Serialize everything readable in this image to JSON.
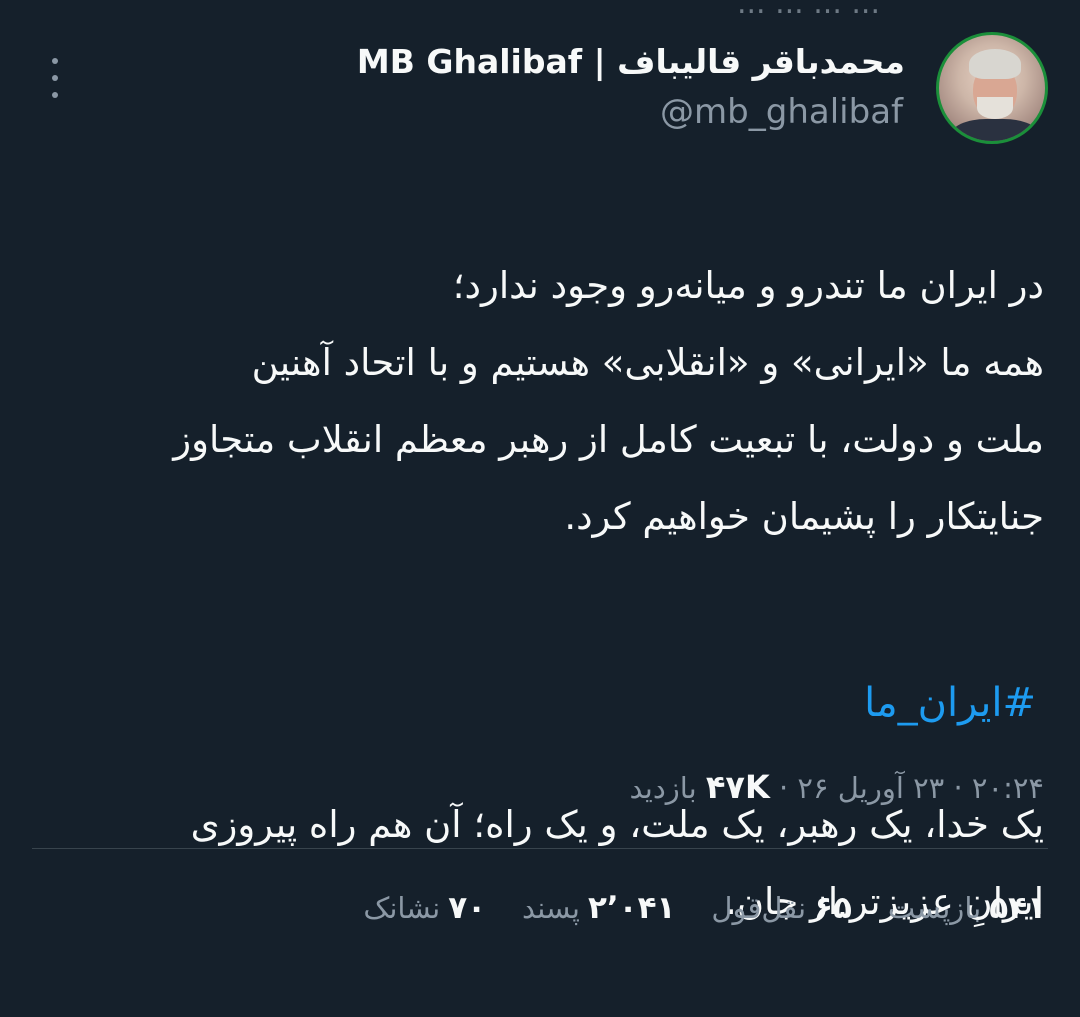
{
  "top_cut_text": "... ... ... ...",
  "header": {
    "display_name": "محمدباقر قالیباف | MB Ghalibaf",
    "handle": "@mb_ghalibaf",
    "more_icon": "more-vertical-icon"
  },
  "tweet": {
    "paragraph_1": "در ایران ما تندرو و میانه‌رو وجود ندارد؛\nهمه ما «ایرانی» و «انقلابی» هستیم و با اتحاد آهنین\nملت و دولت، با تبعیت کامل از رهبر معظم انقلاب متجاوز\nجنایتکار را پشیمان خواهیم کرد.",
    "paragraph_2": "یک خدا، یک رهبر، یک ملت، و یک راه؛ آن هم راه پیروزی\nایرانِ عزیزتر از جان.",
    "hashtag": "#ایران_ما"
  },
  "meta": {
    "time": "۲۰:۲۴",
    "date": "۲۳ آوریل ۲۶",
    "views_count": "۴۷K",
    "views_label": "بازدید",
    "separator": "·"
  },
  "stats": [
    {
      "count": "۵۴۱",
      "label": "بازپست"
    },
    {
      "count": "۶۵",
      "label": "نقل‌قول"
    },
    {
      "count": "۲٬۰۴۱",
      "label": "پسند"
    },
    {
      "count": "۷۰",
      "label": "نشانک"
    }
  ],
  "colors": {
    "background": "#15202b",
    "text_primary": "#f7f9f9",
    "text_secondary": "#8b98a5",
    "link": "#1d9bf0",
    "divider": "#38444d"
  }
}
